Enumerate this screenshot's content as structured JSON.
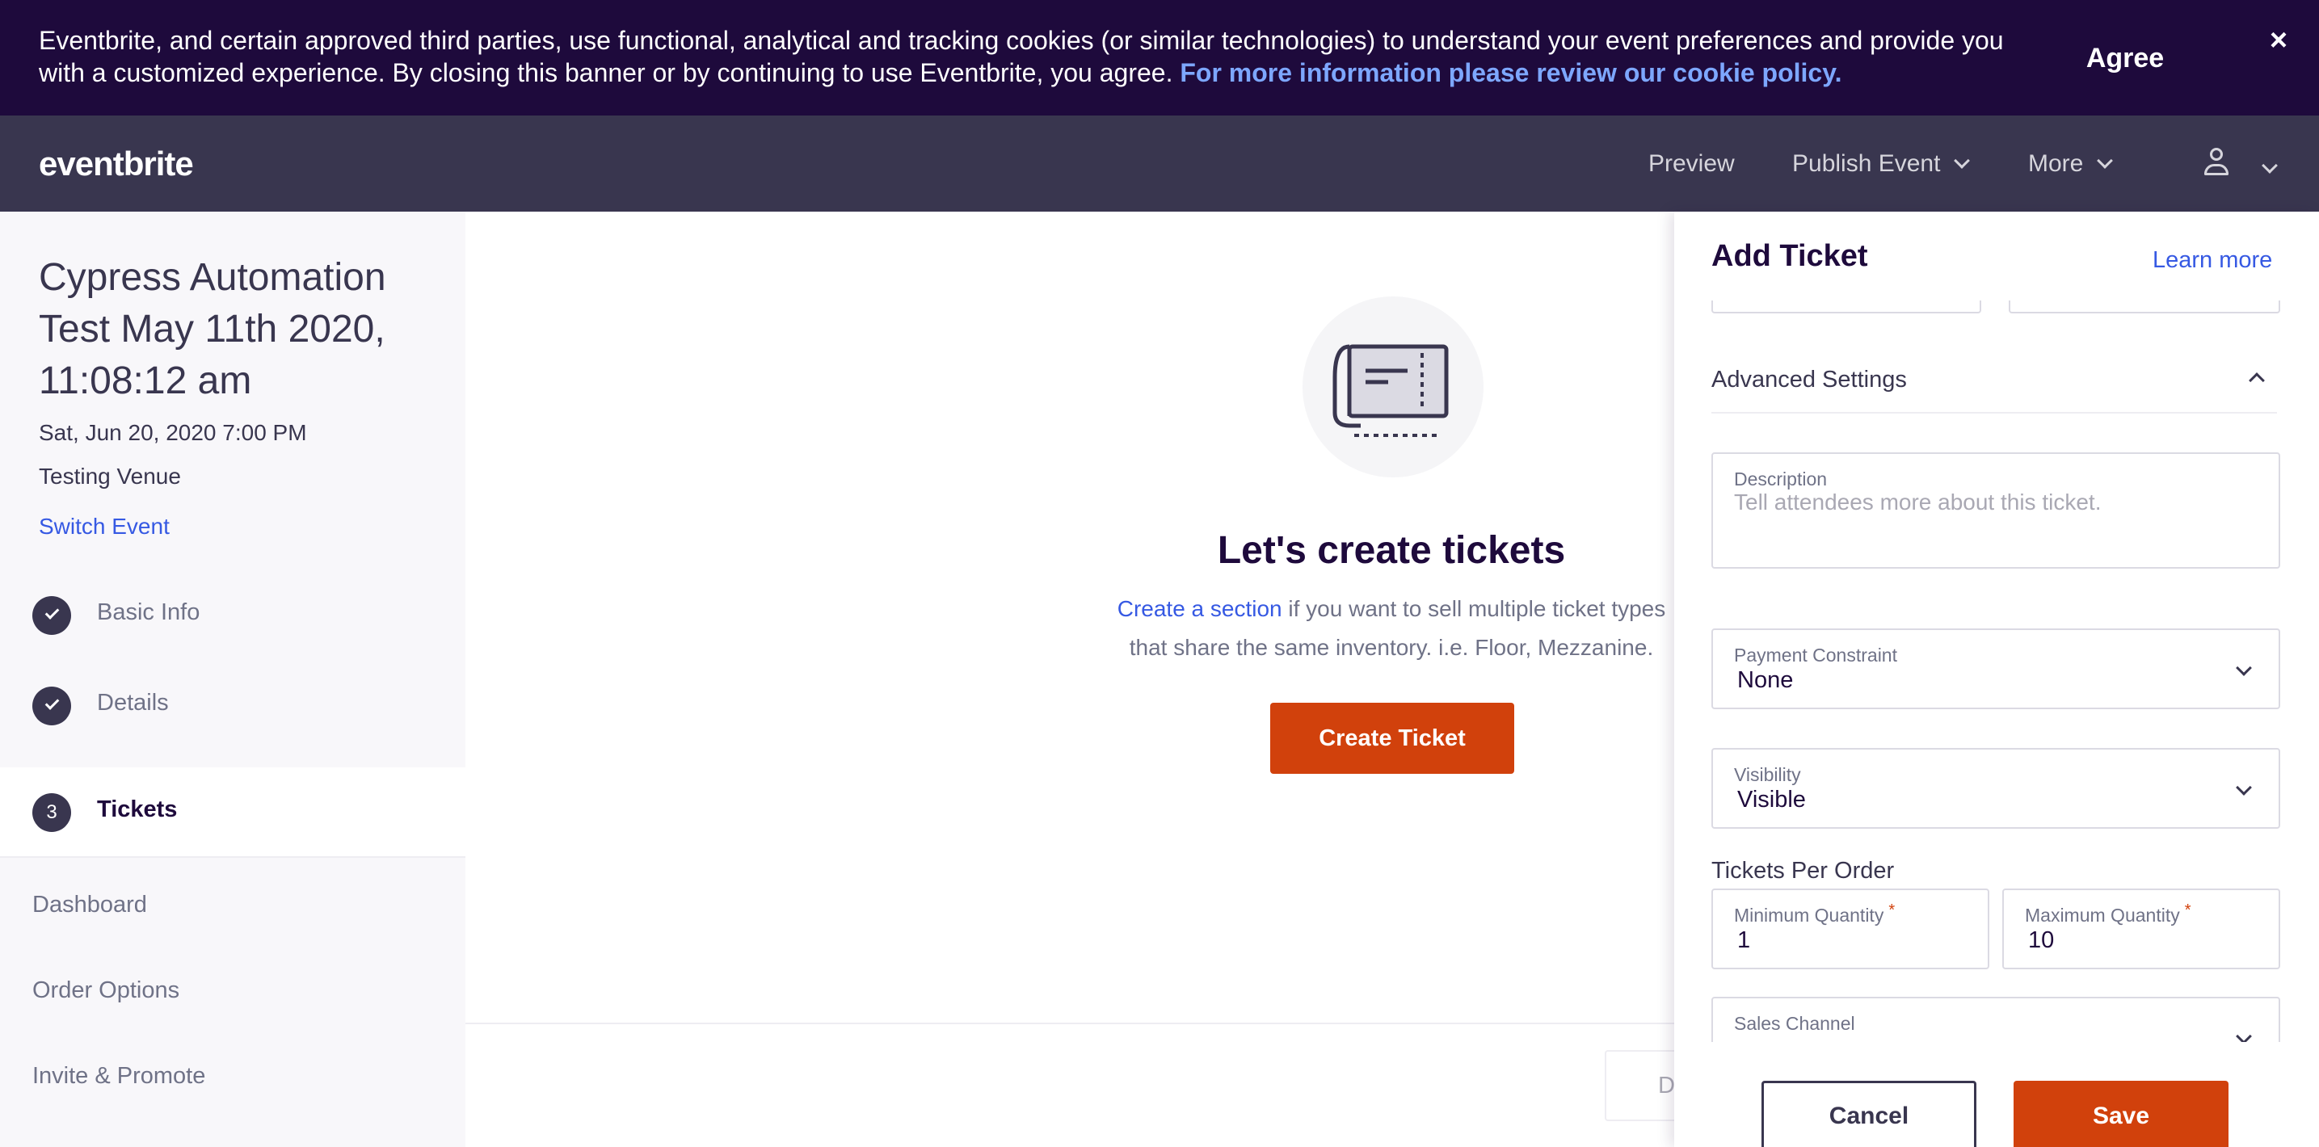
{
  "cookie_banner": {
    "text": "Eventbrite, and certain approved third parties, use functional, analytical and tracking cookies (or similar technologies) to understand your event preferences and provide you with a customized experience. By closing this banner or by continuing to use Eventbrite, you agree.",
    "link_text": "For more information please review our cookie policy.",
    "agree_label": "Agree",
    "close_icon": "×"
  },
  "nav": {
    "logo": "eventbrite",
    "preview": "Preview",
    "publish": "Publish Event",
    "more": "More",
    "user_icon": "user-icon"
  },
  "sidebar": {
    "event_title": "Cypress Automation Test May 11th 2020, 11:08:12 am",
    "event_date": "Sat, Jun 20, 2020 7:00 PM",
    "venue": "Testing Venue",
    "switch_event": "Switch Event",
    "steps": [
      {
        "label": "Basic Info",
        "state": "done"
      },
      {
        "label": "Details",
        "state": "done"
      },
      {
        "label": "Tickets",
        "state": "active",
        "number": "3"
      }
    ],
    "links": [
      "Dashboard",
      "Order Options",
      "Invite & Promote"
    ]
  },
  "main": {
    "title": "Let's create tickets",
    "desc_link": "Create a section",
    "desc_line1_rest": " if you want to sell multiple ticket types",
    "desc_line2": "that share the same inventory. i.e. Floor, Mezzanine.",
    "create_button": "Create Ticket",
    "ghost_button": "D"
  },
  "panel": {
    "title": "Add Ticket",
    "learn_more": "Learn more",
    "advanced_settings": "Advanced Settings",
    "description_label": "Description",
    "description_placeholder": "Tell attendees more about this ticket.",
    "payment_label": "Payment Constraint",
    "payment_value": "None",
    "visibility_label": "Visibility",
    "visibility_value": "Visible",
    "tickets_per_order": "Tickets Per Order",
    "min_label": "Minimum Quantity",
    "min_value": "1",
    "max_label": "Maximum Quantity",
    "max_value": "10",
    "required_mark": "*",
    "sales_channel_label": "Sales Channel",
    "cancel": "Cancel",
    "save": "Save"
  },
  "colors": {
    "banner_bg": "#1e0a3c",
    "nav_bg": "#39364f",
    "accent": "#d1410c",
    "link": "#3659e3"
  }
}
